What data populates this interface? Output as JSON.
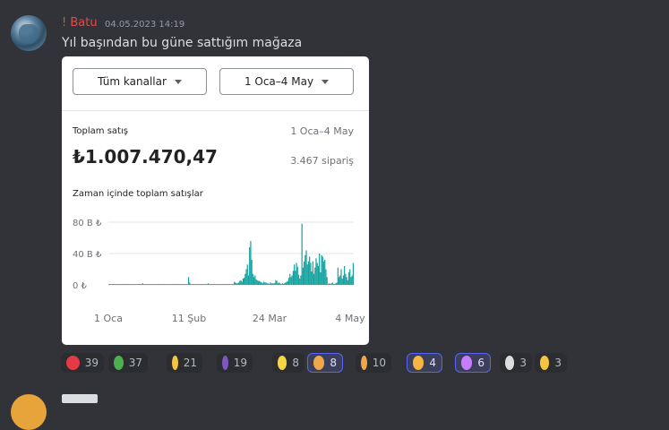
{
  "message": {
    "username": "! Batu",
    "timestamp": "04.05.2023 14:19",
    "text": "Yıl başından bu güne sattığım mağaza"
  },
  "card": {
    "channels_button": "Tüm kanallar",
    "date_button": "1 Oca–4 May",
    "total_sales_label": "Toplam satış",
    "date_range": "1 Oca–4 May",
    "total_value": "₺1.007.470,47",
    "orders": "3.467 sipariş",
    "chart_title": "Zaman içinde toplam satışlar"
  },
  "chart_data": {
    "type": "bar",
    "title": "Zaman içinde toplam satışlar",
    "y_unit": "B ₺",
    "ylim": [
      0,
      80
    ],
    "y_ticks": [
      "80 B ₺",
      "40 B ₺",
      "0 ₺"
    ],
    "x_ticks": [
      "1 Oca",
      "11 Şub",
      "24 Mar",
      "4 May"
    ],
    "color": "#17a3a0",
    "grid": true,
    "values": [
      1,
      1,
      1,
      1,
      1,
      1,
      1,
      1,
      1,
      1,
      1,
      1,
      1,
      1,
      1,
      1,
      1,
      1,
      1,
      1,
      1,
      1,
      1,
      1,
      1,
      1,
      1,
      1,
      1,
      1,
      1,
      2,
      1,
      1,
      1,
      1,
      1,
      1,
      1,
      1,
      1,
      1,
      1,
      1,
      1,
      1,
      1,
      1,
      1,
      1,
      1,
      1,
      1,
      1,
      1,
      1,
      1,
      1,
      1,
      1,
      1,
      1,
      1,
      1,
      1,
      1,
      1,
      1,
      1,
      1,
      1,
      1,
      1,
      10,
      3,
      1,
      1,
      1,
      1,
      1,
      1,
      1,
      1,
      1,
      1,
      1,
      1,
      1,
      1,
      1,
      1,
      2,
      1,
      1,
      1,
      1,
      1,
      1,
      1,
      1,
      1,
      1,
      1,
      1,
      1,
      1,
      1,
      1,
      1,
      1,
      1,
      1,
      1,
      1,
      1,
      4,
      3,
      2,
      2,
      3,
      5,
      6,
      4,
      8,
      9,
      14,
      20,
      26,
      12,
      48,
      56,
      32,
      14,
      10,
      12,
      7,
      6,
      5,
      5,
      4,
      3,
      2,
      4,
      3,
      3,
      2,
      2,
      1,
      3,
      2,
      2,
      2,
      2,
      6,
      5,
      2,
      3,
      2,
      1,
      2,
      1,
      2,
      3,
      4,
      5,
      9,
      14,
      10,
      12,
      18,
      26,
      18,
      28,
      23,
      13,
      8,
      12,
      78,
      22,
      30,
      38,
      44,
      26,
      30,
      36,
      28,
      17,
      30,
      14,
      22,
      34,
      28,
      24,
      40,
      16,
      38,
      36,
      30,
      32,
      20,
      10,
      1,
      2,
      1,
      2,
      3,
      1,
      1,
      2,
      3,
      22,
      10,
      12,
      20,
      8,
      12,
      24,
      14,
      10,
      6,
      16,
      20,
      10,
      12,
      28
    ]
  },
  "reactions": [
    {
      "emoji": "100",
      "count": "39",
      "bg": "#e63946"
    },
    {
      "emoji": "money",
      "count": "37",
      "bg": "#4caf50"
    },
    {
      "emoji": "crown",
      "count": "21",
      "bg": "#f5c542"
    },
    {
      "emoji": "rocket",
      "count": "19",
      "bg": "#7e57c2"
    },
    {
      "emoji": "chick",
      "count": "8",
      "bg": "#f5d547"
    },
    {
      "emoji": "face-hand",
      "count": "8",
      "bg": "#f0a64a",
      "me": true
    },
    {
      "emoji": "face-hand",
      "count": "10",
      "bg": "#f0a64a"
    },
    {
      "emoji": "cold-sweat",
      "count": "4",
      "bg": "#f5b642",
      "me": true
    },
    {
      "emoji": "unicorn",
      "count": "6",
      "bg": "#c77dff",
      "me": true
    },
    {
      "emoji": "goat",
      "count": "3",
      "bg": "#dddddd"
    },
    {
      "emoji": "sunglasses",
      "count": "3",
      "bg": "#f5c542"
    }
  ]
}
